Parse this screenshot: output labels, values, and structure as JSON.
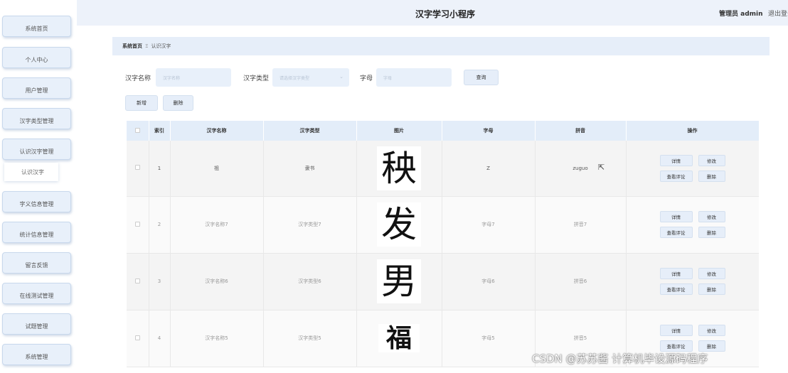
{
  "app_title": "汉字学习小程序",
  "header": {
    "admin_label": "管理员 admin",
    "logout_label": "退出登录"
  },
  "sidebar": {
    "items": [
      {
        "label": "系统首页"
      },
      {
        "label": "个人中心"
      },
      {
        "label": "用户管理"
      },
      {
        "label": "汉字类型管理"
      },
      {
        "label": "认识汉字管理"
      },
      {
        "label": "字义信息管理"
      },
      {
        "label": "统计信息管理"
      },
      {
        "label": "留言反馈"
      },
      {
        "label": "在线测试管理"
      },
      {
        "label": "试题管理"
      },
      {
        "label": "系统管理"
      }
    ],
    "sub_item": "认识汉字"
  },
  "breadcrumb": {
    "home": "系统首页",
    "separator": "Ξ",
    "current": "认识汉字"
  },
  "search": {
    "name_label": "汉字名称",
    "name_placeholder": "汉字名称",
    "type_label": "汉字类型",
    "type_placeholder": "请选择汉字类型",
    "letter_label": "字母",
    "letter_placeholder": "字母",
    "query_button": "查询"
  },
  "toolbar": {
    "add_button": "新增",
    "delete_button": "删除"
  },
  "table": {
    "columns": [
      "",
      "索引",
      "汉字名称",
      "汉字类型",
      "图片",
      "字母",
      "拼音",
      "操作"
    ],
    "rows": [
      {
        "index": "1",
        "name": "祖",
        "type": "隶书",
        "glyph": "秧",
        "letter": "Z",
        "pinyin": "zuguo"
      },
      {
        "index": "2",
        "name": "汉字名称7",
        "type": "汉字类型7",
        "glyph": "发",
        "letter": "字母7",
        "pinyin": "拼音7"
      },
      {
        "index": "3",
        "name": "汉字名称6",
        "type": "汉字类型6",
        "glyph": "男",
        "letter": "字母6",
        "pinyin": "拼音6"
      },
      {
        "index": "4",
        "name": "汉字名称5",
        "type": "汉字类型5",
        "glyph": "福",
        "letter": "字母5",
        "pinyin": "拼音5"
      }
    ],
    "actions": {
      "detail": "详情",
      "edit": "修改",
      "comments": "查看评论",
      "delete": "删除"
    }
  },
  "watermark": "CSDN @苏苏酱 计算机毕设源码程序",
  "colors": {
    "accent_bg": "#e6eef9",
    "sidebar_btn": "#e8f0fa",
    "header_bg": "#edf2fa"
  }
}
